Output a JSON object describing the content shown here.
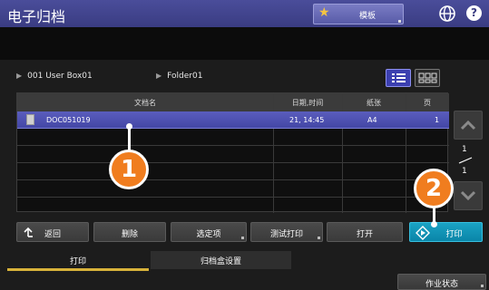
{
  "header": {
    "title": "电子归档",
    "template_label": "模板"
  },
  "breadcrumb": {
    "box": "001  User Box01",
    "folder": "Folder01"
  },
  "table": {
    "columns": [
      "文档名",
      "日期,时间",
      "纸张",
      "页"
    ],
    "rows": [
      {
        "name": "DOC051019",
        "datetime": "21, 14:45",
        "paper": "A4",
        "pages": "1"
      }
    ]
  },
  "pager": {
    "current": "1",
    "total": "1"
  },
  "actions": {
    "back": "返回",
    "delete": "删除",
    "options": "选定项",
    "test_print": "测试打印",
    "open": "打开",
    "print": "打印"
  },
  "tabs": {
    "print": "打印",
    "box_settings": "归档盒设置"
  },
  "job_status": "作业状态",
  "callouts": [
    "1",
    "2"
  ],
  "colors": {
    "title_bar": "#3f4189",
    "selected_row": "#4f52b2",
    "print_button": "#1296ba",
    "callout": "#f07d1f",
    "tab_underline": "#d7b23a"
  }
}
